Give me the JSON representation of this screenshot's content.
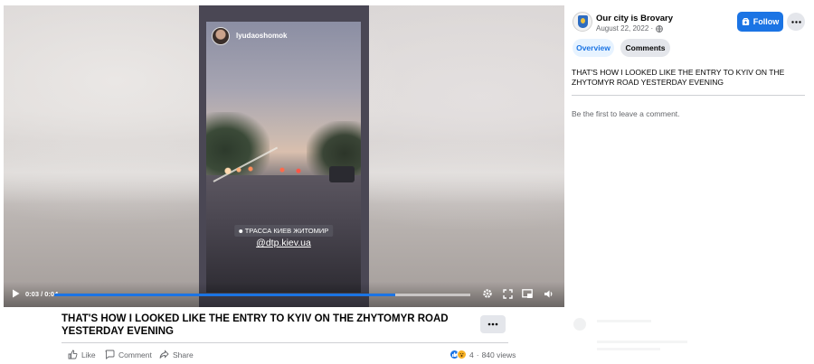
{
  "video": {
    "story_username": "lyudaoshomok",
    "location_sticker": "ТРАССА КИЕВ ЖИТОМИР",
    "mention_tag": "@dtp.kiev.ua",
    "time_display": "0:03 / 0:04",
    "progress_fraction": 0.82
  },
  "post": {
    "title": "THAT'S HOW I LOOKED LIKE THE ENTRY TO KYIV ON THE ZHYTOMYR ROAD YESTERDAY EVENING",
    "actions": {
      "like": "Like",
      "comment": "Comment",
      "share": "Share"
    },
    "reactions": {
      "count": "4",
      "separator": "·",
      "views": "840 views"
    }
  },
  "side": {
    "page_name": "Our city is Brovary",
    "date": "August 22, 2022 ·",
    "follow_label": "Follow",
    "tabs": {
      "overview": "Overview",
      "comments": "Comments"
    },
    "description": "THAT'S HOW I LOOKED LIKE THE ENTRY TO KYIV ON THE ZHYTOMYR ROAD YESTERDAY EVENING",
    "empty_comments": "Be the first to leave a comment."
  },
  "colors": {
    "accent": "#1b74e4",
    "secondary_text": "#65676b",
    "button_grey": "#e4e6eb"
  },
  "icons": [
    "play-icon",
    "gear-icon",
    "fullscreen-icon",
    "pip-icon",
    "volume-icon",
    "more-icon",
    "like-icon",
    "comment-icon",
    "share-icon",
    "globe-icon",
    "follow-icon"
  ]
}
